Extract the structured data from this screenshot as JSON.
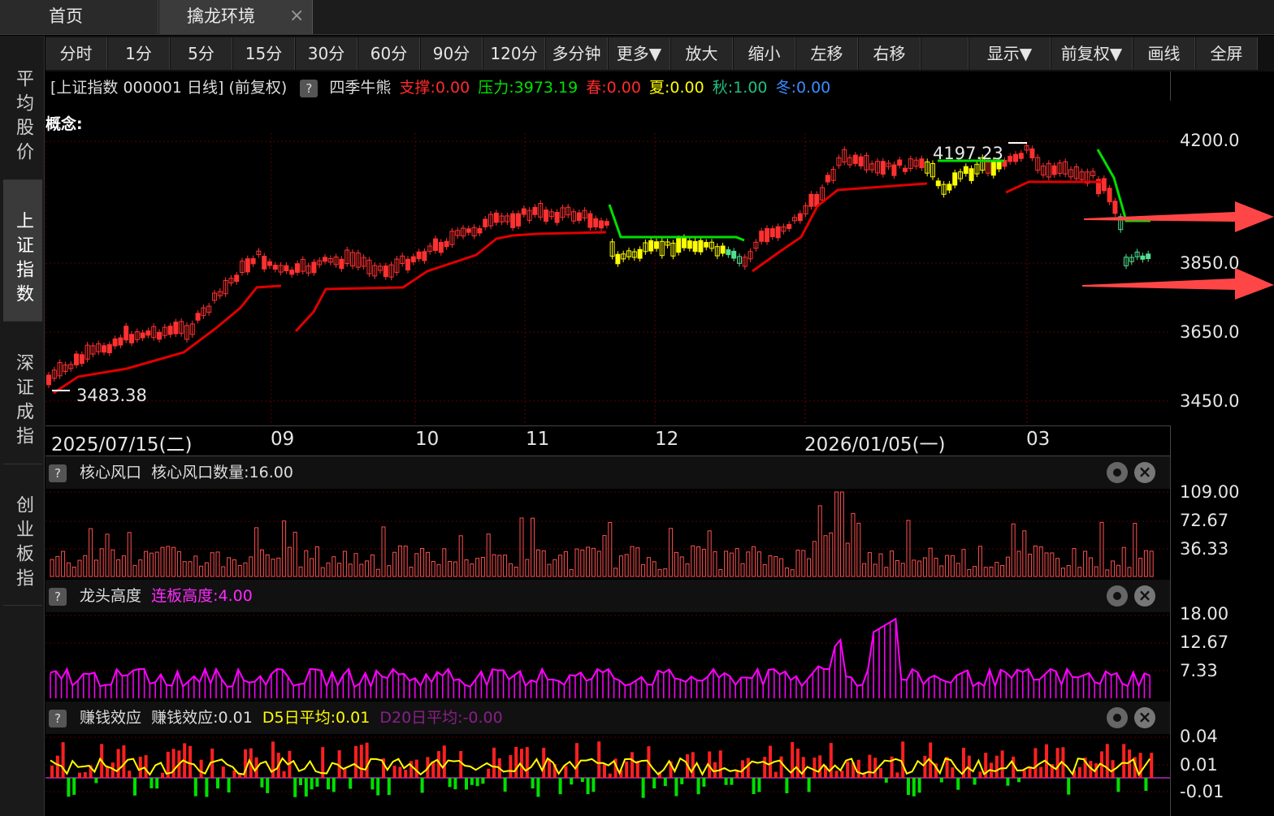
{
  "tabs": [
    {
      "label": "首页"
    },
    {
      "label": "擒龙环境",
      "close": "×"
    }
  ],
  "sidebar": {
    "items": [
      {
        "label": "平均股价"
      },
      {
        "label": "上证指数",
        "active": true
      },
      {
        "label": "深证成指"
      },
      {
        "label": "创业板指"
      }
    ]
  },
  "toolbar": {
    "buttons": [
      "分时",
      "1分",
      "5分",
      "15分",
      "30分",
      "60分",
      "90分",
      "120分",
      "多分钟",
      "更多▼",
      "放大",
      "缩小",
      "左移",
      "右移",
      "",
      "显示▼",
      "前复权▼",
      "画线",
      "全屏"
    ]
  },
  "main": {
    "title": "[上证指数 000001 日线]",
    "adj": "(前复权)",
    "qmark": "?",
    "indicator": "四季牛熊",
    "support": "支撑:0.00",
    "pressure": "压力:3973.19",
    "spring": "春:0.00",
    "summer": "夏:0.00",
    "autumn": "秋:1.00",
    "winter": "冬:0.00",
    "concept": "概念:",
    "high_label": "4197.23",
    "low_label": "3483.38",
    "y_labels": [
      "4200.0",
      "3850.0",
      "3650.0",
      "3450.0"
    ],
    "date_labels": [
      "2025/07/15(二)",
      "09",
      "10",
      "11",
      "12",
      "2026/01/05(一)",
      "03"
    ]
  },
  "panel1": {
    "name": "核心风口",
    "value_label": "核心风口数量:16.00",
    "y_labels": [
      "109.00",
      "72.67",
      "36.33"
    ]
  },
  "panel2": {
    "name": "龙头高度",
    "value_label": "连板高度:4.00",
    "y_labels": [
      "18.00",
      "12.67",
      "7.33"
    ]
  },
  "panel3": {
    "name": "赚钱效应",
    "value_label": "赚钱效应:0.01",
    "d5": "D5日平均:0.01",
    "d20": "D20日平均:-0.00",
    "y_labels": [
      "0.04",
      "0.01",
      "-0.01"
    ]
  },
  "colors": {
    "up": "#ff3232",
    "down": "#54ffff",
    "green": "#00e000",
    "yellow": "#ffff00",
    "magenta": "#ff00ff",
    "gridline": "#5a0000"
  }
}
